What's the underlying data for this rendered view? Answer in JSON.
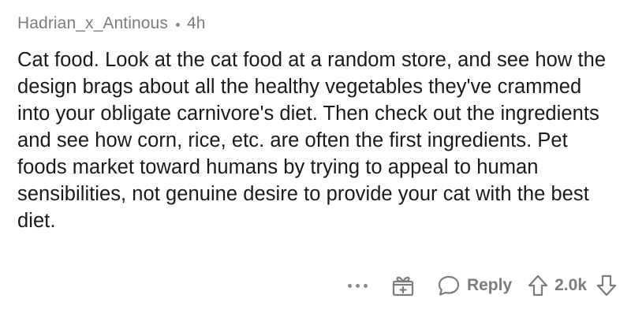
{
  "comment": {
    "username": "Hadrian_x_Antinous",
    "time": "4h",
    "body": "Cat food. Look at the cat food at a random store, and see how the design brags about all the healthy vegetables they've crammed into your obligate carnivore's diet. Then check out the ingredients and see how corn, rice, etc. are often the first ingredients. Pet foods market toward humans by trying to appeal to human sensibilities, not genuine desire to provide your cat with the best diet."
  },
  "actions": {
    "more_icon": "more-horizontal-icon",
    "gift_icon": "gift-award-icon",
    "reply_icon": "speech-bubble-icon",
    "reply_label": "Reply",
    "upvote_icon": "upvote-arrow-icon",
    "score": "2.0k",
    "downvote_icon": "downvote-arrow-icon"
  },
  "colors": {
    "text": "#1a1a1b",
    "meta": "#7c7c7c",
    "icon": "#878a8c",
    "background": "#ffffff"
  }
}
